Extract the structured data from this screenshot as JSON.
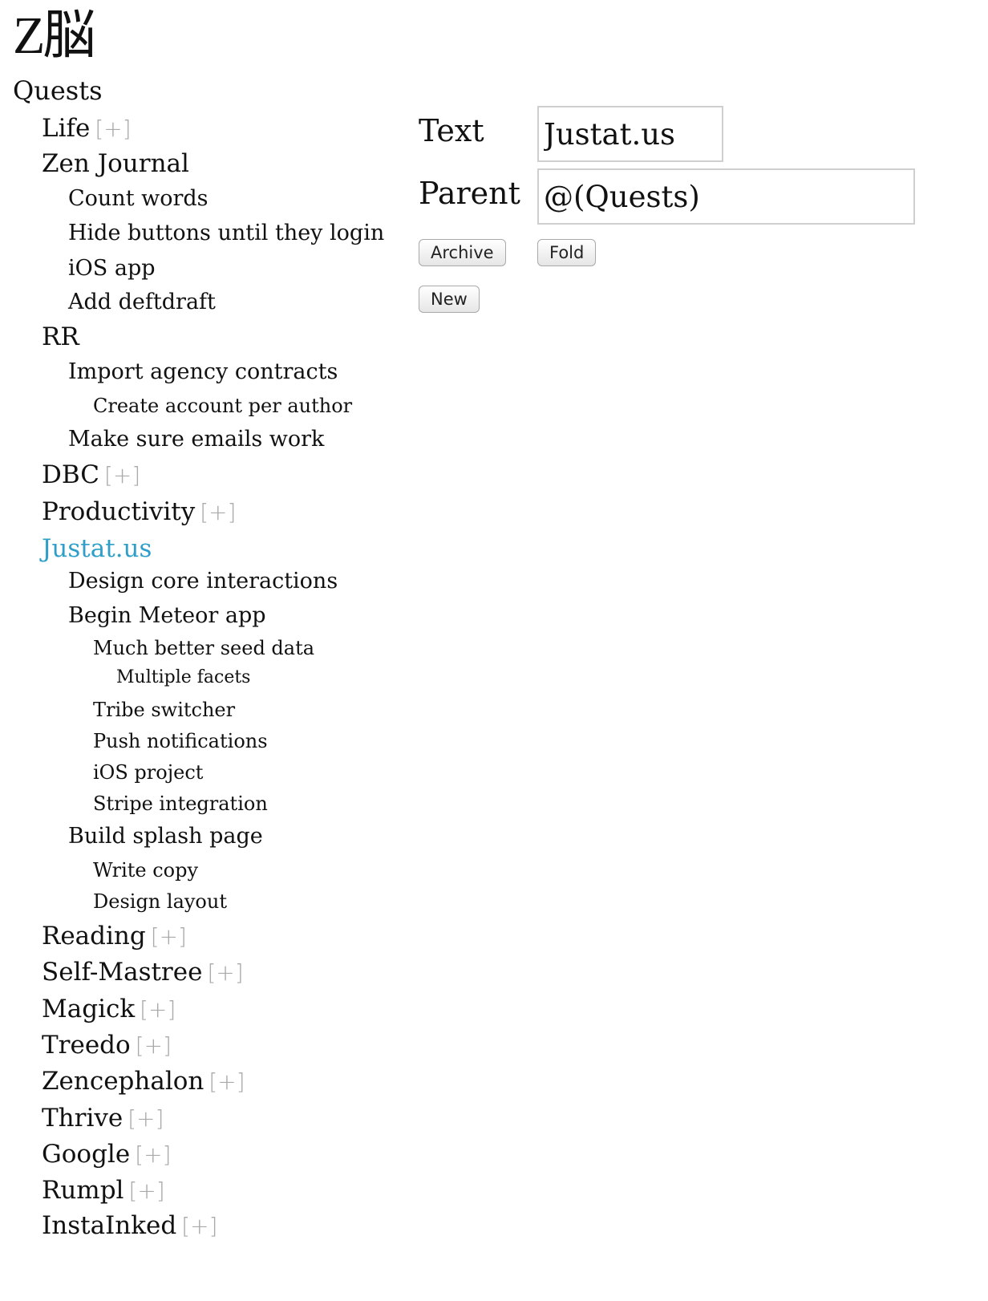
{
  "app": {
    "logo": "Z脳"
  },
  "tree": {
    "root_label": "Quests",
    "expander": "[+]",
    "items": [
      {
        "label": "Life",
        "collapsed": true
      },
      {
        "label": "Zen Journal"
      },
      {
        "label": "Count words"
      },
      {
        "label": "Hide buttons until they login"
      },
      {
        "label": "iOS app"
      },
      {
        "label": "Add deftdraft"
      },
      {
        "label": "RR"
      },
      {
        "label": "Import agency contracts"
      },
      {
        "label": "Create account per author"
      },
      {
        "label": "Make sure emails work"
      },
      {
        "label": "DBC",
        "collapsed": true
      },
      {
        "label": "Productivity",
        "collapsed": true
      },
      {
        "label": "Justat.us",
        "selected": true
      },
      {
        "label": "Design core interactions"
      },
      {
        "label": "Begin Meteor app"
      },
      {
        "label": "Much better seed data"
      },
      {
        "label": "Multiple facets"
      },
      {
        "label": "Tribe switcher"
      },
      {
        "label": "Push notifications"
      },
      {
        "label": "iOS project"
      },
      {
        "label": "Stripe integration"
      },
      {
        "label": "Build splash page"
      },
      {
        "label": "Write copy"
      },
      {
        "label": "Design layout"
      },
      {
        "label": "Reading",
        "collapsed": true
      },
      {
        "label": "Self-Mastree",
        "collapsed": true
      },
      {
        "label": "Magick",
        "collapsed": true
      },
      {
        "label": "Treedo",
        "collapsed": true
      },
      {
        "label": "Zencephalon",
        "collapsed": true
      },
      {
        "label": "Thrive",
        "collapsed": true
      },
      {
        "label": "Google",
        "collapsed": true
      },
      {
        "label": "Rumpl",
        "collapsed": true
      },
      {
        "label": "InstaInked",
        "collapsed": true
      }
    ]
  },
  "editor": {
    "text_label": "Text",
    "text_value": "Justat.us",
    "parent_label": "Parent",
    "parent_value": "@(Quests)",
    "archive_label": "Archive",
    "fold_label": "Fold",
    "new_label": "New"
  },
  "colors": {
    "selected": "#2f9fc9",
    "expander": "#aaaaaa"
  }
}
